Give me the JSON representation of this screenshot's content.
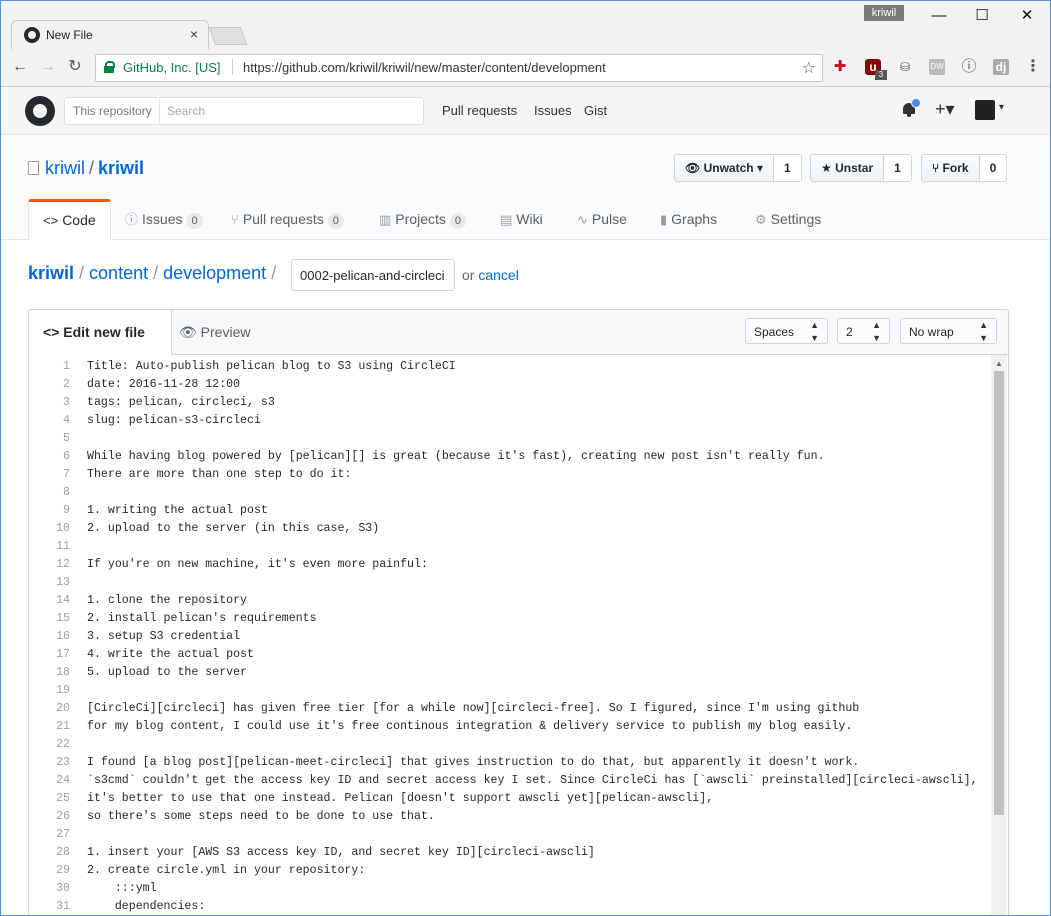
{
  "browser": {
    "tab_title": "New File",
    "tab_close": "×",
    "user": "kriwil",
    "window_controls": [
      "—",
      "☐",
      "✕"
    ],
    "cert_label": "GitHub, Inc. [US]",
    "url": "https://github.com/kriwil/kriwil/new/master/content/development",
    "nav_icons": [
      "back-arrow-icon",
      "forward-arrow-icon",
      "reload-icon"
    ],
    "extension_icons": [
      "red-cross-icon",
      "ublock-icon",
      "database-icon",
      "dwr-icon",
      "info-circle-icon",
      "dj-icon",
      "menu-icon"
    ],
    "ublock_badge": "3"
  },
  "github": {
    "search_scope": "This repository",
    "search_placeholder": "Search",
    "nav": [
      "Pull requests",
      "Issues",
      "Gist"
    ],
    "plus": "+▾",
    "repo_owner": "kriwil",
    "repo_name": "kriwil",
    "watch_label": "Unwatch",
    "watch_count": "1",
    "star_label": "Unstar",
    "star_count": "1",
    "fork_label": "Fork",
    "fork_count": "0",
    "tabs": [
      {
        "label": "Code",
        "icon": "<>",
        "count": ""
      },
      {
        "label": "Issues",
        "icon": "ⓘ",
        "count": "0"
      },
      {
        "label": "Pull requests",
        "icon": "⑂",
        "count": "0"
      },
      {
        "label": "Projects",
        "icon": "▥",
        "count": "0"
      },
      {
        "label": "Wiki",
        "icon": "▤",
        "count": ""
      },
      {
        "label": "Pulse",
        "icon": "∿",
        "count": ""
      },
      {
        "label": "Graphs",
        "icon": "▮",
        "count": ""
      },
      {
        "label": "Settings",
        "icon": "⚙",
        "count": ""
      }
    ]
  },
  "breadcrumb": {
    "root": "kriwil",
    "parts": [
      "content",
      "development"
    ],
    "filename_value": "0002-pelican-and-circleci",
    "or_text": "or",
    "cancel": "cancel"
  },
  "editor": {
    "tab_edit": "Edit new file",
    "tab_preview": "Preview",
    "indent_mode": "Spaces",
    "indent_size": "2",
    "wrap_mode": "No wrap",
    "lines": [
      "Title: Auto-publish pelican blog to S3 using CircleCI",
      "date: 2016-11-28 12:00",
      "tags: pelican, circleci, s3",
      "slug: pelican-s3-circleci",
      "",
      "While having blog powered by [pelican][] is great (because it's fast), creating new post isn't really fun.",
      "There are more than one step to do it:",
      "",
      "1. writing the actual post",
      "2. upload to the server (in this case, S3)",
      "",
      "If you're on new machine, it's even more painful:",
      "",
      "1. clone the repository",
      "2. install pelican's requirements",
      "3. setup S3 credential",
      "4. write the actual post",
      "5. upload to the server",
      "",
      "[CircleCi][circleci] has given free tier [for a while now][circleci-free]. So I figured, since I'm using github",
      "for my blog content, I could use it's free continous integration & delivery service to publish my blog easily.",
      "",
      "I found [a blog post][pelican-meet-circleci] that gives instruction to do that, but apparently it doesn't work.",
      "`s3cmd` couldn't get the access key ID and secret access key I set. Since CircleCi has [`awscli` preinstalled][circleci-awscli],",
      "it's better to use that one instead. Pelican [doesn't support awscli yet][pelican-awscli],",
      "so there's some steps need to be done to use that.",
      "",
      "1. insert your [AWS S3 access key ID, and secret key ID][circleci-awscli]",
      "2. create circle.yml in your repository:",
      "    :::yml",
      "    dependencies:"
    ]
  }
}
